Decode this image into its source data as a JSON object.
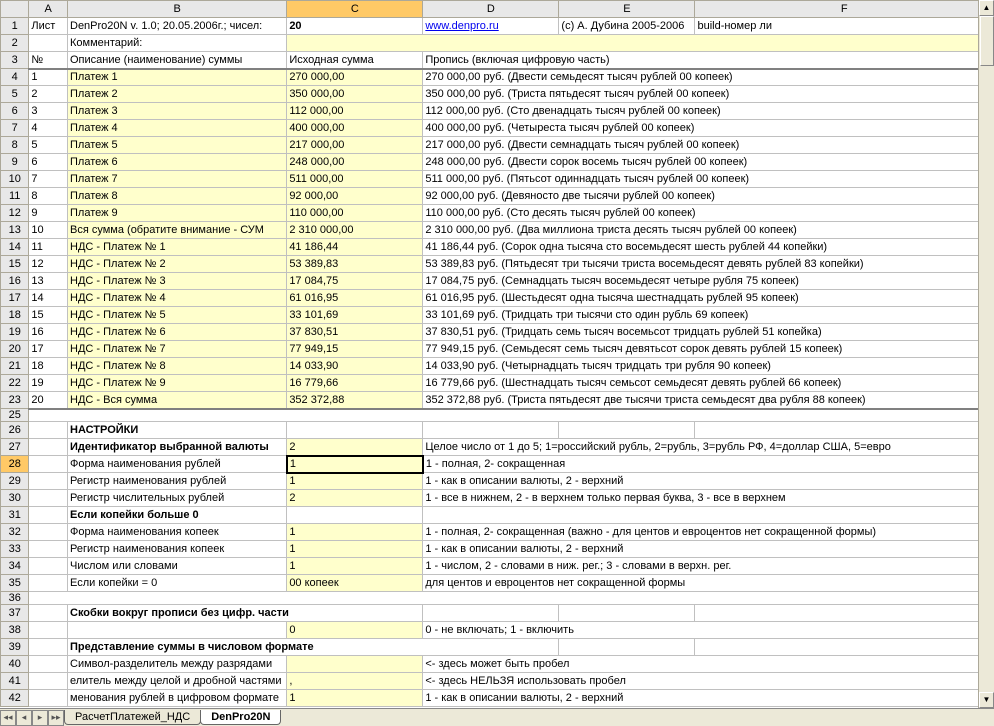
{
  "headers": {
    "A": "A",
    "B": "B",
    "C": "C",
    "D": "D",
    "E": "E",
    "F": "F"
  },
  "row1": {
    "a": "Лист",
    "b": "DenPro20N v. 1.0; 20.05.2006г.; чисел:",
    "c": "20",
    "d": "www.denpro.ru",
    "e": "(с) А. Дубина 2005-2006",
    "f": "build-номер ли"
  },
  "row2": {
    "b": "Комментарий:"
  },
  "row3": {
    "a": "№",
    "b": "Описание (наименование) суммы",
    "c": "Исходная сумма",
    "d": "Пропись (включая цифровую часть)"
  },
  "payments": [
    {
      "n": "1",
      "b": "Платеж 1",
      "c": "270 000,00",
      "d": "270 000,00 руб. (Двести семьдесят тысяч рублей 00 копеек)"
    },
    {
      "n": "2",
      "b": "Платеж 2",
      "c": "350 000,00",
      "d": "350 000,00 руб. (Триста пятьдесят тысяч рублей 00 копеек)"
    },
    {
      "n": "3",
      "b": "Платеж 3",
      "c": "112 000,00",
      "d": "112 000,00 руб. (Сто двенадцать тысяч рублей 00 копеек)"
    },
    {
      "n": "4",
      "b": "Платеж 4",
      "c": "400 000,00",
      "d": "400 000,00 руб. (Четыреста тысяч рублей 00 копеек)"
    },
    {
      "n": "5",
      "b": "Платеж 5",
      "c": "217 000,00",
      "d": "217 000,00 руб. (Двести семнадцать тысяч рублей 00 копеек)"
    },
    {
      "n": "6",
      "b": "Платеж 6",
      "c": "248 000,00",
      "d": "248 000,00 руб. (Двести сорок восемь тысяч рублей 00 копеек)"
    },
    {
      "n": "7",
      "b": "Платеж 7",
      "c": "511 000,00",
      "d": "511 000,00 руб. (Пятьсот одиннадцать тысяч рублей 00 копеек)"
    },
    {
      "n": "8",
      "b": "Платеж 8",
      "c": "92 000,00",
      "d": "92 000,00 руб. (Девяносто две тысячи рублей 00 копеек)"
    },
    {
      "n": "9",
      "b": "Платеж 9",
      "c": "110 000,00",
      "d": "110 000,00 руб. (Сто десять тысяч рублей 00 копеек)"
    },
    {
      "n": "10",
      "b": "Вся сумма (обратите внимание - СУМ",
      "c": "2 310 000,00",
      "d": "2 310 000,00 руб. (Два миллиона триста десять тысяч рублей 00 копеек)"
    },
    {
      "n": "11",
      "b": "НДС - Платеж № 1",
      "c": "41 186,44",
      "d": "41 186,44 руб. (Сорок одна тысяча сто восемьдесят шесть рублей 44 копейки)"
    },
    {
      "n": "12",
      "b": "НДС - Платеж № 2",
      "c": "53 389,83",
      "d": "53 389,83 руб. (Пятьдесят три тысячи триста восемьдесят девять рублей 83 копейки)"
    },
    {
      "n": "13",
      "b": "НДС - Платеж № 3",
      "c": "17 084,75",
      "d": "17 084,75 руб. (Семнадцать тысяч восемьдесят четыре рубля 75 копеек)"
    },
    {
      "n": "14",
      "b": "НДС - Платеж № 4",
      "c": "61 016,95",
      "d": "61 016,95 руб. (Шестьдесят одна тысяча шестнадцать рублей 95 копеек)"
    },
    {
      "n": "15",
      "b": "НДС - Платеж № 5",
      "c": "33 101,69",
      "d": "33 101,69 руб. (Тридцать три тысячи сто один рубль 69 копеек)"
    },
    {
      "n": "16",
      "b": "НДС - Платеж № 6",
      "c": "37 830,51",
      "d": "37 830,51 руб. (Тридцать семь тысяч восемьсот тридцать рублей 51 копейка)"
    },
    {
      "n": "17",
      "b": "НДС - Платеж № 7",
      "c": "77 949,15",
      "d": "77 949,15 руб. (Семьдесят семь тысяч девятьсот сорок девять рублей 15 копеек)"
    },
    {
      "n": "18",
      "b": "НДС - Платеж № 8",
      "c": "14 033,90",
      "d": "14 033,90 руб. (Четырнадцать тысяч тридцать три рубля 90 копеек)"
    },
    {
      "n": "19",
      "b": "НДС - Платеж № 9",
      "c": "16 779,66",
      "d": "16 779,66 руб. (Шестнадцать тысяч семьсот семьдесят девять рублей 66 копеек)"
    },
    {
      "n": "20",
      "b": "НДС - Вся сумма",
      "c": "352 372,88",
      "d": "352 372,88 руб. (Триста пятьдесят две тысячи триста семьдесят два рубля 88 копеек)"
    }
  ],
  "settings": {
    "title": "НАСТРОЙКИ",
    "rows": [
      {
        "r": "27",
        "b": "Идентификатор выбранной валюты",
        "c": "2",
        "d": "Целое число от 1 до 5; 1=российский рубль, 2=рубль, 3=рубль РФ, 4=доллар США, 5=евро",
        "bold": true
      },
      {
        "r": "28",
        "b": "Форма наименования рублей",
        "c": "1",
        "d": "1 - полная, 2- сокращенная",
        "sel": true,
        "drop": true
      },
      {
        "r": "29",
        "b": "Регистр наименования рублей",
        "c": "1",
        "d": "1 - как в описании валюты, 2 - верхний"
      },
      {
        "r": "30",
        "b": "Регистр числительных рублей",
        "c": "2",
        "d": "1 - все в нижнем, 2 - в верхнем только первая буква, 3 - все в верхнем"
      },
      {
        "r": "31",
        "b": "Если копейки больше 0",
        "c": "",
        "d": "",
        "bold": true,
        "plain": true
      },
      {
        "r": "32",
        "b": "Форма наименования копеек",
        "c": "1",
        "d": "1 - полная, 2- сокращенная (важно - для центов и евроцентов нет сокращенной формы)"
      },
      {
        "r": "33",
        "b": "Регистр наименования копеек",
        "c": "1",
        "d": "1 - как в описании валюты, 2 - верхний"
      },
      {
        "r": "34",
        "b": "Числом или словами",
        "c": "1",
        "d": "1 - числом, 2 - словами в ниж. рег.; 3 - словами в верхн. рег."
      },
      {
        "r": "35",
        "b": "Если копейки = 0",
        "c": "00 копеек",
        "d": "для центов и евроцентов нет сокращенной формы"
      }
    ],
    "brackets": {
      "r": "37",
      "b": "Скобки вокруг прописи без цифр. части"
    },
    "brackets2": {
      "r": "38",
      "c": "0",
      "d": "0 - не включать; 1 - включить"
    },
    "format_title": {
      "r": "39",
      "b": "Представление суммы в числовом формате"
    },
    "rows2": [
      {
        "r": "40",
        "b": "Символ-разделитель между разрядами",
        "c": "",
        "d": "<- здесь может быть пробел"
      },
      {
        "r": "41",
        "b": "елитель между целой и дробной частями",
        "c": ",",
        "d": "<- здесь НЕЛЬЗЯ использовать пробел"
      },
      {
        "r": "42",
        "b": "менования рублей в цифровом формате",
        "c": "1",
        "d": "1 - как в описании валюты, 2 - верхний"
      }
    ]
  },
  "tabs": {
    "t1": "РасчетПлатежей_НДС",
    "t2": "DenPro20N"
  }
}
